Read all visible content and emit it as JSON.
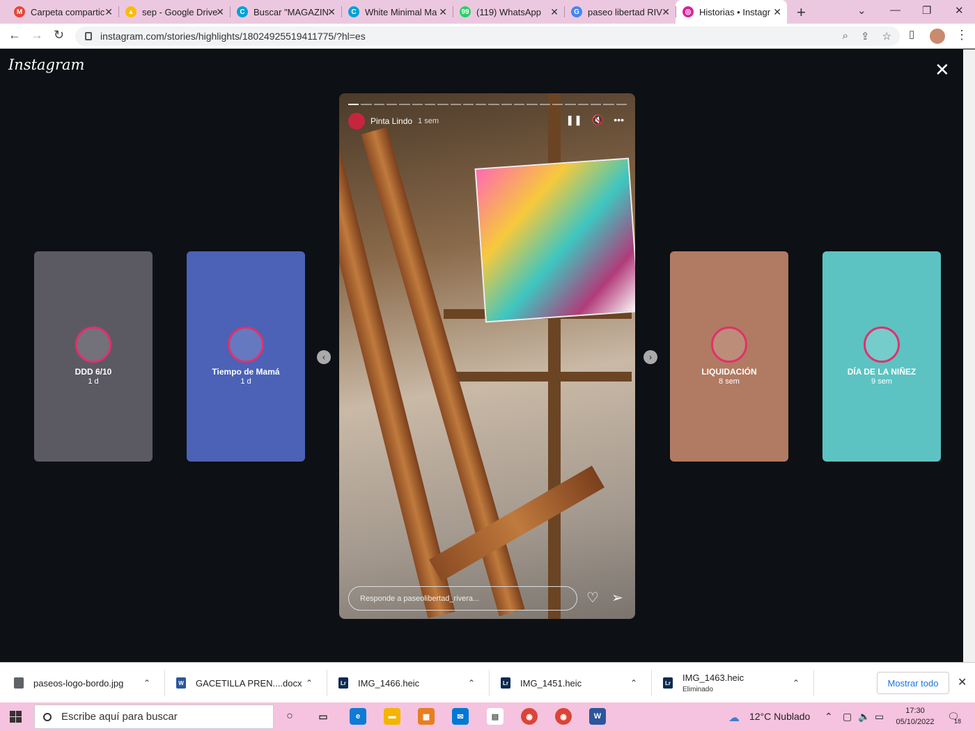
{
  "browser": {
    "tabs": [
      {
        "title": "Carpeta compartic",
        "icon": "gmail-icon",
        "color": "#ea4335",
        "glyph": "M"
      },
      {
        "title": "sep - Google Drive",
        "icon": "google-drive-icon",
        "color": "#fbbc04",
        "glyph": "▲"
      },
      {
        "title": "Buscar \"MAGAZIN",
        "icon": "canva-icon",
        "color": "#00a2d6",
        "glyph": "C"
      },
      {
        "title": "White Minimal Ma",
        "icon": "canva-icon",
        "color": "#00a2d6",
        "glyph": "C"
      },
      {
        "title": "(119) WhatsApp",
        "icon": "whatsapp-icon",
        "color": "#25d366",
        "glyph": "99"
      },
      {
        "title": "paseo libertad RIV",
        "icon": "google-icon",
        "color": "#4285f4",
        "glyph": "G"
      },
      {
        "title": "Historias • Instagr",
        "icon": "instagram-icon",
        "color": "#d6249f",
        "glyph": "◎"
      }
    ],
    "url": "instagram.com/stories/highlights/18024925519411775/?hl=es"
  },
  "instagram": {
    "logo": "Instagram",
    "highlights_left": [
      {
        "name": "DDD 6/10",
        "time": "1 d",
        "color": "#5b5a63"
      },
      {
        "name": "Tiempo de Mamá",
        "time": "1 d",
        "color": "#4b62b6"
      }
    ],
    "highlights_right": [
      {
        "name": "LIQUIDACIÓN",
        "time": "8 sem",
        "color": "#b17a62"
      },
      {
        "name": "DÍA DE LA NIÑEZ",
        "time": "9 sem",
        "color": "#5cc3c2"
      }
    ],
    "story": {
      "author": "Pinta Lindo",
      "time": "1 sem",
      "reply_placeholder": "Responde a paseolibertad_rivera...",
      "progress_total": 22,
      "progress_done": 1
    }
  },
  "downloads": [
    {
      "name": "paseos-logo-bordo.jpg",
      "sub": "",
      "icon": "image-file-icon",
      "color": "#5f6368",
      "glyph": ""
    },
    {
      "name": "GACETILLA PREN....docx",
      "sub": "",
      "icon": "word-file-icon",
      "color": "#2b579a",
      "glyph": "W"
    },
    {
      "name": "IMG_1466.heic",
      "sub": "",
      "icon": "lightroom-icon",
      "color": "#0c2a52",
      "glyph": "Lr"
    },
    {
      "name": "IMG_1451.heic",
      "sub": "",
      "icon": "lightroom-icon",
      "color": "#0c2a52",
      "glyph": "Lr"
    },
    {
      "name": "IMG_1463.heic",
      "sub": "Eliminado",
      "icon": "lightroom-icon",
      "color": "#0c2a52",
      "glyph": "Lr"
    }
  ],
  "downloads_show_all": "Mostrar todo",
  "taskbar": {
    "search_placeholder": "Escribe aquí para buscar",
    "weather": "12°C  Nublado",
    "time": "17:30",
    "date": "05/10/2022",
    "notifications": "18"
  }
}
